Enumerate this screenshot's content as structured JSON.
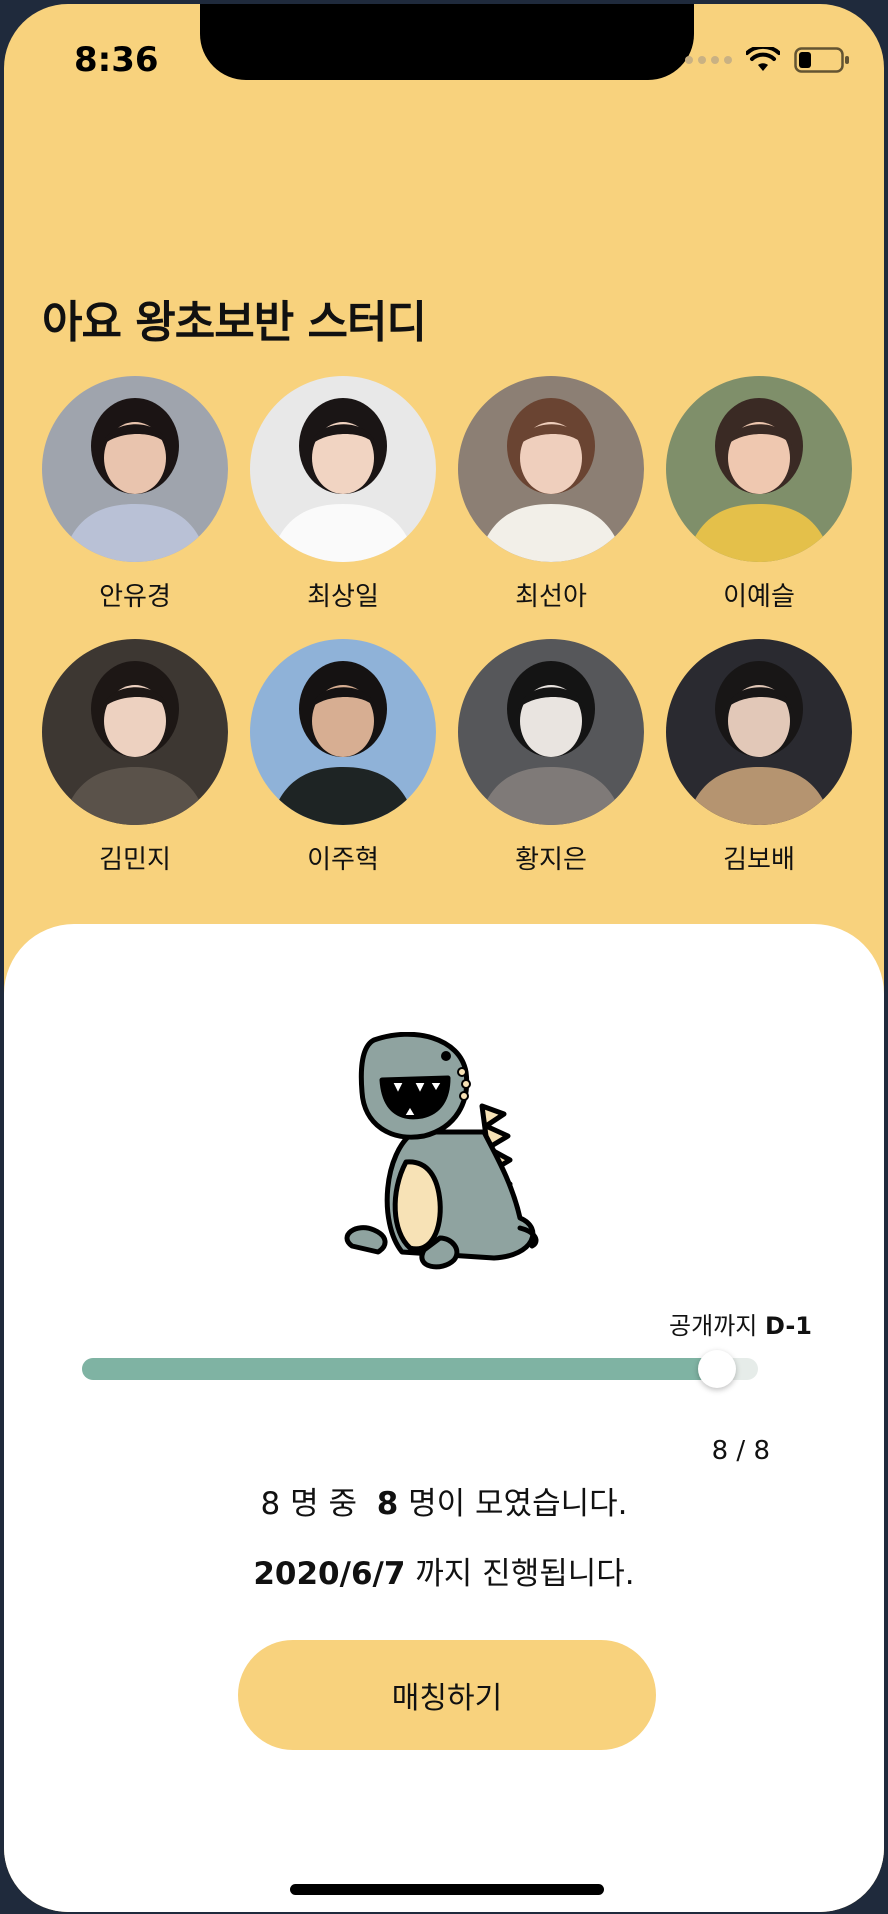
{
  "status_bar": {
    "time": "8:36"
  },
  "study": {
    "title": "아요 왕초보반 스터디"
  },
  "members": [
    {
      "name": "안유경",
      "bg": "#9fa4ad",
      "skin": "#e9c4ae",
      "hair": "#1b1414",
      "shirt": "#b9c1d6"
    },
    {
      "name": "최상일",
      "bg": "#e8e8e8",
      "skin": "#f1d4c2",
      "hair": "#1a1515",
      "shirt": "#fafafa"
    },
    {
      "name": "최선아",
      "bg": "#8c7f74",
      "skin": "#efcfbd",
      "hair": "#6a4432",
      "shirt": "#f2efe8"
    },
    {
      "name": "이예슬",
      "bg": "#7f8f6a",
      "skin": "#efc8b0",
      "hair": "#3a2a24",
      "shirt": "#e4c04a"
    },
    {
      "name": "김민지",
      "bg": "#3d3732",
      "skin": "#edd1c0",
      "hair": "#1d1715",
      "shirt": "#5a524a"
    },
    {
      "name": "이주혁",
      "bg": "#8fb2d8",
      "skin": "#d7ae92",
      "hair": "#151212",
      "shirt": "#1e2424"
    },
    {
      "name": "황지은",
      "bg": "#56575a",
      "skin": "#e9e4e0",
      "hair": "#141414",
      "shirt": "#7f7a78"
    },
    {
      "name": "김보배",
      "bg": "#2a2a30",
      "skin": "#e2c8b8",
      "hair": "#181616",
      "shirt": "#b59470"
    }
  ],
  "progress": {
    "countdown_label": "공개까지",
    "countdown_value": "D-1",
    "fraction": 0.94,
    "count_text": "8 / 8"
  },
  "summary": {
    "total": "8",
    "total_suffix": "명 중",
    "joined": "8",
    "joined_suffix": "명이 모였습니다.",
    "end_date": "2020/6/7",
    "end_suffix": "까지 진행됩니다."
  },
  "actions": {
    "match_label": "매칭하기"
  },
  "colors": {
    "primary": "#f8d27d",
    "progress": "#7fb3a3",
    "dino": "#8fa3a0",
    "dino_belly": "#f7e2b6"
  }
}
